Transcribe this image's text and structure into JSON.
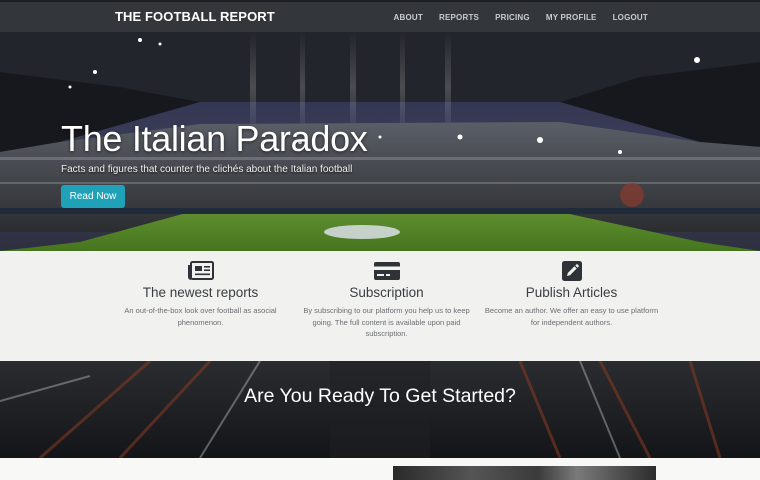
{
  "navbar": {
    "brand": "THE FOOTBALL REPORT",
    "links": [
      {
        "label": "ABOUT"
      },
      {
        "label": "REPORTS"
      },
      {
        "label": "PRICING"
      },
      {
        "label": "MY PROFILE"
      },
      {
        "label": "LOGOUT"
      }
    ]
  },
  "hero": {
    "title": "The Italian Paradox",
    "subtitle": "Facts and figures that counter the clichés about the Italian football",
    "button_label": "Read Now"
  },
  "features": [
    {
      "icon": "newspaper-icon",
      "title": "The newest reports",
      "description": "An out-of-the-box look over football as asocial phenomenon."
    },
    {
      "icon": "credit-card-icon",
      "title": "Subscription",
      "description": "By subscribing to our platform you help us to keep going. The full content is available upon paid subscription."
    },
    {
      "icon": "pencil-square-icon",
      "title": "Publish Articles",
      "description": "Become an author. We offer an easy to use platform for independent authors."
    }
  ],
  "cta": {
    "heading": "Are You Ready To Get Started?"
  },
  "colors": {
    "navbar_bg": "#33363b",
    "button_accent": "#1fa2b8",
    "feature_bg": "#f1f1ef"
  }
}
